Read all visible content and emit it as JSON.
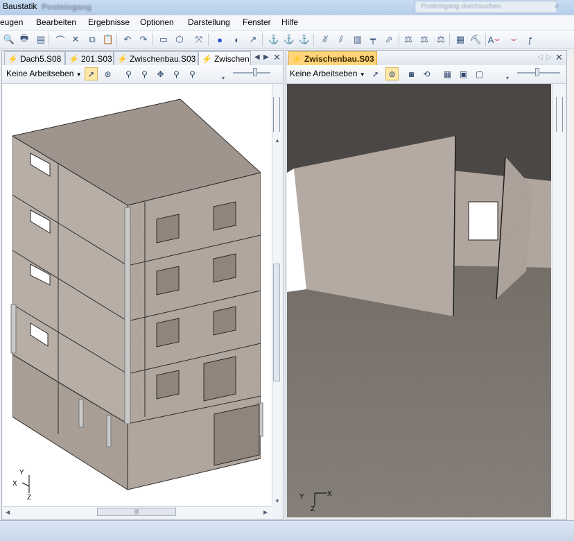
{
  "window": {
    "app_title": "Baustatik",
    "doc_title": "Posteingang",
    "search_placeholder": "Posteingang durchsuchen"
  },
  "menu": [
    "eugen",
    "Bearbeiten",
    "Ergebnisse",
    "Optionen",
    "Darstellung",
    "Fenster",
    "Hilfe"
  ],
  "toolbar_icons": [
    "print-preview-icon",
    "print-icon",
    "page-setup-icon",
    "lasso-icon",
    "delete-icon",
    "copy-icon",
    "paste-icon",
    "undo-icon",
    "redo-icon",
    "open-model-icon",
    "cube-view-icon",
    "structure-icon",
    "sphere-icon",
    "render-icon",
    "measure-icon",
    "load-icon",
    "load2-icon",
    "load3-icon",
    "beam-icon",
    "slab-icon",
    "wall-icon",
    "column-icon",
    "ramp-icon",
    "support-icon",
    "support2-icon",
    "support3-icon",
    "table-icon",
    "tools-icon",
    "text-icon",
    "moment-icon",
    "moment2-icon",
    "formula-icon"
  ],
  "left_panel": {
    "tabs": [
      "Dach5.S08",
      "201.S03",
      "Zwischenbau.S03",
      "Zwischen"
    ],
    "layer_select": "Keine Arbeitseben",
    "axis": {
      "x": "X",
      "y": "Y",
      "z": "Z"
    }
  },
  "right_panel": {
    "tabs": [
      "Zwischenbau.S03"
    ],
    "layer_select": "Keine Arbeitseben",
    "axis": {
      "x": "X",
      "y": "Y",
      "z": "Z"
    }
  },
  "colors": {
    "active_tab": "#ffd47a",
    "concrete": "#b7aca3",
    "floor_dark": "#6c6661"
  }
}
